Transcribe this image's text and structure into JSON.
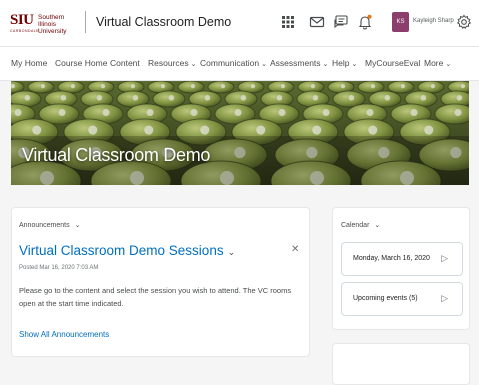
{
  "header": {
    "logo": {
      "siu": "SIU",
      "university": "Southern Illinois University",
      "campus": "CARBONDALE"
    },
    "course_title": "Virtual Classroom Demo",
    "icons": [
      "apps-grid-icon",
      "mail-icon",
      "chat-icon",
      "bell-icon",
      "gear-icon"
    ],
    "avatar_initials": "KS",
    "user_name": "Kayleigh Sharp"
  },
  "nav": {
    "items": [
      {
        "label": "My Home",
        "dropdown": false
      },
      {
        "label": "Course Home",
        "dropdown": false
      },
      {
        "label": "Content",
        "dropdown": false
      },
      {
        "label": "Resources",
        "dropdown": true
      },
      {
        "label": "Communication",
        "dropdown": true
      },
      {
        "label": "Assessments",
        "dropdown": true
      },
      {
        "label": "Help",
        "dropdown": true
      },
      {
        "label": "MyCourseEval",
        "dropdown": false
      },
      {
        "label": "More",
        "dropdown": true
      }
    ]
  },
  "banner": {
    "title": "Virtual Classroom Demo"
  },
  "announcements": {
    "widget_title": "Announcements",
    "item_title": "Virtual Classroom Demo Sessions",
    "posted": "Posted Mar 16, 2020 7:03 AM",
    "body": "Please go to the content and select the session you wish to attend. The VC rooms open at the start time indicated.",
    "show_all": "Show All Announcements"
  },
  "calendar": {
    "widget_title": "Calendar",
    "date": "Monday, March 16, 2020",
    "upcoming": "Upcoming events (5)"
  },
  "colors": {
    "accent": "#006fbf",
    "brand": "#720000",
    "avatar": "#8b3d6c"
  }
}
